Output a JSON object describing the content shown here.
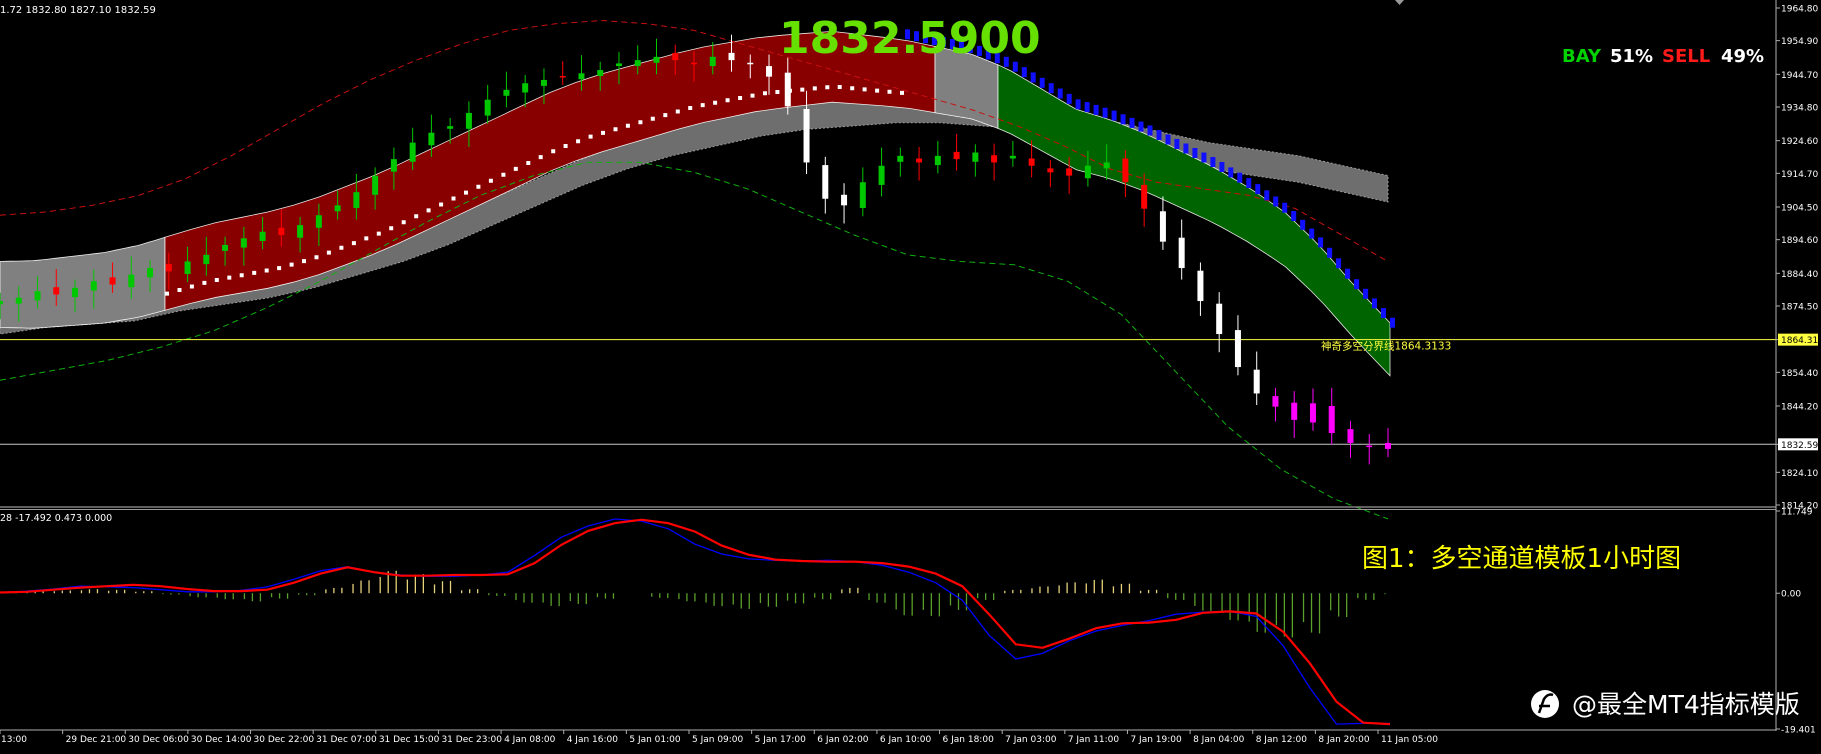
{
  "ohlc_header": "1.72 1832.80 1827.10 1832.59",
  "big_price": "1832.5900",
  "bay_sell": {
    "bay_label": "BAY",
    "bay_pct": "51%",
    "sell_label": "SELL",
    "sell_pct": "49%",
    "bay_color": "#00d200",
    "sell_color": "#ff1a1a"
  },
  "caption": "图1：多空通道模板1小时图",
  "watermark": "@最全MT4指标模版",
  "colors": {
    "up_candle": "#00c800",
    "down_candle": "#ff0000",
    "magenta": "#ff00ff",
    "bull_channel": "#880000",
    "bear_channel": "#006400",
    "neutral_channel": "#808080",
    "blue_dots": "#1010ff",
    "yellow_line": "#ffff40",
    "caption": "#ffff00",
    "macd_line": "#ff0000",
    "signal_line": "#0000ff"
  },
  "chart_data": [
    {
      "type": "candlestick",
      "price_axis_ticks": [
        "1964.80",
        "1954.90",
        "1944.70",
        "1934.80",
        "1924.60",
        "1914.70",
        "1904.50",
        "1894.60",
        "1884.40",
        "1874.50",
        "1864.31",
        "1854.40",
        "1844.20",
        "1832.59",
        "1824.10",
        "1814.20"
      ],
      "ylim": [
        1814.2,
        1964.8
      ],
      "time_axis_labels": [
        "13:00",
        "29 Dec 21:00",
        "30 Dec 06:00",
        "30 Dec 14:00",
        "30 Dec 22:00",
        "31 Dec 07:00",
        "31 Dec 15:00",
        "31 Dec 23:00",
        "4 Jan 08:00",
        "4 Jan 16:00",
        "5 Jan 01:00",
        "5 Jan 09:00",
        "5 Jan 17:00",
        "6 Jan 02:00",
        "6 Jan 10:00",
        "6 Jan 18:00",
        "7 Jan 03:00",
        "7 Jan 11:00",
        "7 Jan 19:00",
        "8 Jan 04:00",
        "8 Jan 12:00",
        "8 Jan 20:00",
        "11 Jan 05:00"
      ],
      "horizontal_line": {
        "value": 1864.31,
        "label": "神奇多空分界线1864.3133",
        "axis_label": "1864.31"
      },
      "current_price": {
        "value": 1832.59,
        "axis_label": "1832.59"
      },
      "mid_line": [
        1878,
        1878,
        1879,
        1880,
        1882,
        1885,
        1888,
        1890,
        1892,
        1895,
        1899,
        1903,
        1908,
        1913,
        1918,
        1923,
        1928,
        1932,
        1935,
        1938,
        1941,
        1943,
        1945,
        1946,
        1947,
        1946,
        1945,
        1943,
        1941,
        1937,
        1931,
        1925,
        1922,
        1918,
        1913,
        1908,
        1902,
        1895,
        1885,
        1873,
        1862
      ],
      "outer_upper": [
        1902,
        1903,
        1905,
        1908,
        1913,
        1920,
        1928,
        1936,
        1943,
        1949,
        1954,
        1958,
        1960,
        1961,
        1960,
        1958,
        1954,
        1950,
        1946,
        1942,
        1938,
        1934,
        1929,
        1923,
        1916,
        1912,
        1910,
        1908,
        1904,
        1896,
        1888
      ],
      "outer_lower": [
        1852,
        1855,
        1858,
        1862,
        1867,
        1874,
        1882,
        1891,
        1900,
        1908,
        1914,
        1918,
        1918,
        1915,
        1910,
        1903,
        1896,
        1890,
        1888,
        1887,
        1882,
        1872,
        1855,
        1838,
        1825,
        1816,
        1810
      ],
      "candle_closes": [
        1876,
        1877,
        1879,
        1878,
        1880,
        1882,
        1881,
        1884,
        1886,
        1885,
        1888,
        1890,
        1893,
        1895,
        1897,
        1896,
        1899,
        1902,
        1905,
        1909,
        1914,
        1919,
        1924,
        1927,
        1929,
        1933,
        1937,
        1940,
        1942,
        1943,
        1944,
        1945,
        1946,
        1948,
        1949,
        1950,
        1949,
        1948,
        1950,
        1949,
        1948,
        1944,
        1935,
        1918,
        1907,
        1905,
        1912,
        1917,
        1920,
        1918,
        1920,
        1919,
        1921,
        1918,
        1920,
        1917,
        1915,
        1914,
        1917,
        1918,
        1912,
        1904,
        1894,
        1886,
        1876,
        1866,
        1856,
        1848,
        1844,
        1840,
        1845,
        1836,
        1833,
        1832,
        1833
      ],
      "macd_ylim": [
        -19.401,
        11.749
      ],
      "macd_ticks": [
        "11.749",
        "0.00",
        "-19.401"
      ],
      "macd_header": "28 -17.492 0.473 0.000",
      "macd_line": [
        0.1,
        0.2,
        0.5,
        0.8,
        1.0,
        1.2,
        1.0,
        0.6,
        0.3,
        0.3,
        0.5,
        1.5,
        2.8,
        3.7,
        3.0,
        2.5,
        2.5,
        2.6,
        2.6,
        2.7,
        4.3,
        6.9,
        8.9,
        10.0,
        10.5,
        10.0,
        8.8,
        6.8,
        5.5,
        4.8,
        4.6,
        4.5,
        4.5,
        4.3,
        3.8,
        2.8,
        1.0,
        -3.0,
        -7.3,
        -7.8,
        -6.5,
        -5.0,
        -4.3,
        -4.2,
        -3.8,
        -2.8,
        -2.6,
        -2.9,
        -5.5,
        -10.0,
        -15.5,
        -18.5,
        -18.7
      ],
      "signal_line": [
        0.1,
        0.3,
        0.6,
        1.0,
        0.9,
        0.8,
        0.5,
        0.2,
        0.2,
        0.4,
        0.9,
        2.0,
        3.2,
        3.8,
        3.0,
        2.6,
        2.4,
        2.4,
        2.6,
        3.0,
        5.4,
        8.0,
        9.6,
        10.6,
        10.3,
        9.2,
        7.0,
        5.6,
        4.9,
        4.7,
        4.6,
        4.7,
        4.5,
        4.0,
        3.0,
        1.5,
        -1.0,
        -6.0,
        -9.4,
        -8.6,
        -6.8,
        -5.4,
        -4.6,
        -3.9,
        -3.0,
        -2.7,
        -2.6,
        -3.3,
        -7.5,
        -13.5,
        -18.7,
        -18.6,
        -18.6
      ],
      "macd_hist": [
        0.1,
        0.3,
        0.4,
        0.6,
        0.5,
        0.3,
        -0.2,
        -0.6,
        -0.9,
        -1.2,
        -0.8,
        -0.3,
        0.8,
        1.9,
        3.3,
        2.8,
        1.8,
        0.6,
        -0.4,
        -1.4,
        -1.9,
        -1.6,
        -0.8,
        0.0,
        -0.7,
        -1.2,
        -1.9,
        -2.3,
        -2.0,
        -1.5,
        -0.9,
        0.8,
        -1.4,
        -3.3,
        -3.4,
        -2.5,
        -1.0,
        0.5,
        1.0,
        1.6,
        2.0,
        1.4,
        0.5,
        -1.0,
        -2.6,
        -4.0,
        -5.8,
        -6.5,
        -5.9,
        -3.5,
        -1.0,
        -0.2
      ]
    }
  ]
}
